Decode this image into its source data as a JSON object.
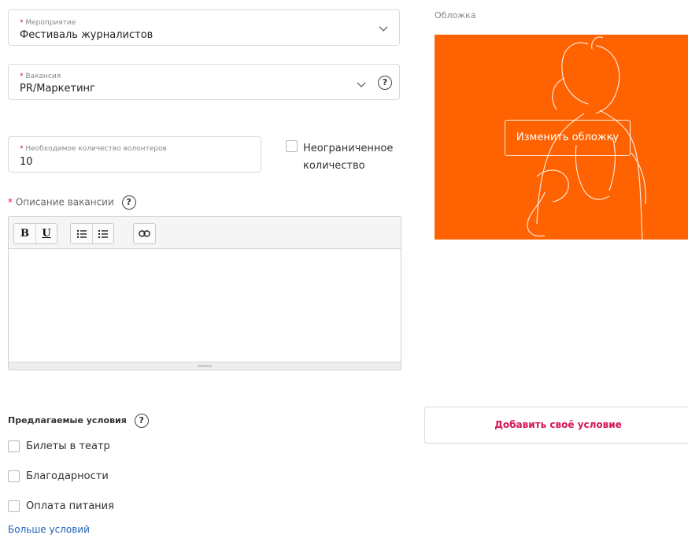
{
  "event_field": {
    "required_mark": "*",
    "label": "Мероприятие",
    "value": "Фестиваль журналистов"
  },
  "vacancy_field": {
    "required_mark": "*",
    "label": "Вакансия",
    "value": "PR/Маркетинг"
  },
  "volunteers_field": {
    "required_mark": "*",
    "label": "Необходимое количество волонтеров",
    "value": "10"
  },
  "unlimited": {
    "label_line1": "Неограниченное",
    "label_line2": "количество",
    "checked": false
  },
  "description": {
    "required_mark": "*",
    "label": "Описание вакансии"
  },
  "toolbar": {
    "bold": "B",
    "underline": "U"
  },
  "cover": {
    "label": "Обложка",
    "change_button": "Изменить обложку",
    "background_color": "#ff6200"
  },
  "conditions": {
    "title": "Предлагаемые условия",
    "items": [
      {
        "label": "Билеты в театр",
        "checked": false
      },
      {
        "label": "Благодарности",
        "checked": false
      },
      {
        "label": "Оплата питания",
        "checked": false
      }
    ],
    "more_link": "Больше условий",
    "add_button": "Добавить своё условие"
  },
  "colors": {
    "accent": "#d4145a",
    "required": "#e3007a",
    "link": "#1e62b6"
  },
  "help_icon": "?"
}
